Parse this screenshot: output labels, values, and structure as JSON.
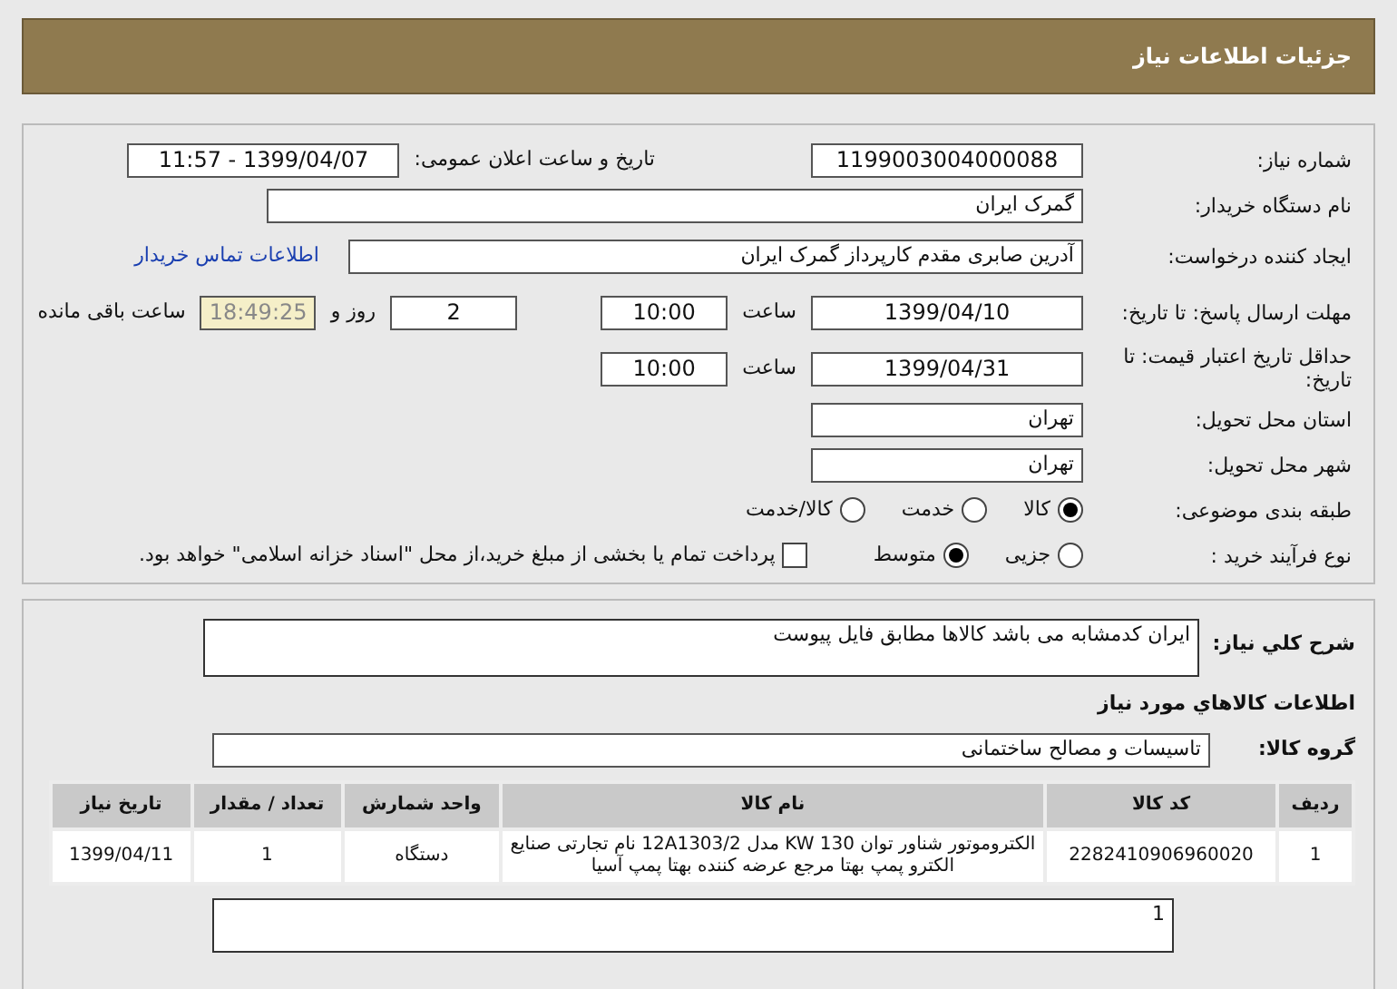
{
  "header": {
    "title": "جزئیات اطلاعات نیاز"
  },
  "need_number": {
    "label": "شماره نیاز:",
    "value": "1199003004000088"
  },
  "announce": {
    "label": "تاریخ و ساعت اعلان عمومی:",
    "value": "1399/04/07 - 11:57"
  },
  "buyer": {
    "label": "نام دستگاه خریدار:",
    "value": "گمرک ایران"
  },
  "creator": {
    "label": "ایجاد کننده درخواست:",
    "value": "آدرین صابری مقدم کارپرداز گمرک ایران",
    "link": "اطلاعات تماس خریدار"
  },
  "deadline": {
    "label": "مهلت ارسال پاسخ: تا تاریخ:",
    "date": "1399/04/10",
    "time_label": "ساعت",
    "time": "10:00",
    "days": "2",
    "days_label": "روز و",
    "remaining": "18:49:25",
    "remaining_label": "ساعت باقی مانده"
  },
  "validity": {
    "label": "حداقل تاریخ اعتبار قیمت: تا تاریخ:",
    "date": "1399/04/31",
    "time_label": "ساعت",
    "time": "10:00"
  },
  "province": {
    "label": "استان محل تحویل:",
    "value": "تهران"
  },
  "city": {
    "label": "شهر محل تحویل:",
    "value": "تهران"
  },
  "category": {
    "label": "طبقه بندی موضوعی:",
    "options": [
      {
        "label": "کالا",
        "selected": true
      },
      {
        "label": "خدمت",
        "selected": false
      },
      {
        "label": "کالا/خدمت",
        "selected": false
      }
    ]
  },
  "process": {
    "label": "نوع فرآیند خرید :",
    "options": [
      {
        "label": "جزیی",
        "selected": false
      },
      {
        "label": "متوسط",
        "selected": true
      }
    ],
    "payment": {
      "label": "پرداخت تمام یا بخشی از مبلغ خرید،از محل \"اسناد خزانه اسلامی\" خواهد بود.",
      "checked": false
    }
  },
  "description": {
    "label": "شرح كلي نياز:",
    "value": "ایران کدمشابه می باشد کالاها مطابق فایل پیوست"
  },
  "goods_heading": "اطلاعات كالاهاي مورد نياز",
  "group": {
    "label": "گروه کالا:",
    "value": "تاسیسات و مصالح ساختمانی"
  },
  "table": {
    "columns": [
      "ردیف",
      "کد کالا",
      "نام کالا",
      "واحد شمارش",
      "تعداد / مقدار",
      "تاریخ نیاز"
    ],
    "rows": [
      [
        "1",
        "2282410906960020",
        "الکتروموتور شناور توان KW 130 مدل 12A1303/2 نام تجارتی صنایع الکترو پمپ بهتا مرجع عرضه کننده بهتا پمپ آسیا",
        "دستگاه",
        "1",
        "1399/04/11"
      ]
    ]
  },
  "note": "1"
}
